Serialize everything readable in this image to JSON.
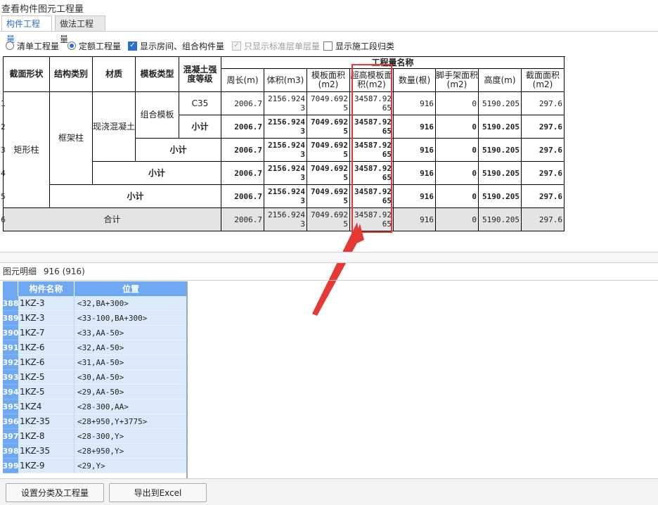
{
  "window": {
    "title": "查看构件图元工程量"
  },
  "tabs": [
    {
      "label": "构件工程量",
      "active": true
    },
    {
      "label": "做法工程量",
      "active": false
    }
  ],
  "options": {
    "radio_list": "清单工程量",
    "radio_quota": "定额工程量",
    "radio_selected": "定额工程量",
    "chk_room": "显示房间、组合构件量",
    "chk_room_checked": true,
    "chk_std_floor": "只显示标准层单层量",
    "chk_std_floor_checked": true,
    "chk_std_floor_disabled": true,
    "chk_segment": "显示施工段归类",
    "chk_segment_checked": false
  },
  "table": {
    "group_header": "工程量名称",
    "headers": {
      "shape": "截面形状",
      "struct": "结构类别",
      "material": "材质",
      "formwork": "模板类型",
      "grade": "混凝土强度等级",
      "perimeter": "周长(m)",
      "volume": "体积(m3)",
      "form_area": "模板面积(m2)",
      "over_form": "超高模板面积(m2)",
      "count": "数量(根)",
      "scaffold": "脚手架面积(m2)",
      "height": "高度(m)",
      "section": "截面面积(m2)"
    },
    "row_numbers": [
      "1",
      "2",
      "3",
      "4",
      "5",
      "6"
    ],
    "merged": {
      "shape": "矩形柱",
      "struct": "框架柱",
      "material": "现浇混凝土",
      "formwork": "组合模板",
      "grade": "C35",
      "subtotal": "小计",
      "total": "合计"
    },
    "values": {
      "perimeter": "2006.7",
      "volume": "2156.9243",
      "form_area": "7049.6925",
      "over_form": "34587.9265",
      "count": "916",
      "scaffold": "0",
      "height": "5190.205",
      "section": "297.6"
    }
  },
  "detail": {
    "label": "图元明细",
    "count_text": "916 (916)",
    "headers": {
      "name": "构件名称",
      "position": "位置"
    },
    "rows": [
      {
        "no": "388",
        "name": "1KZ-3",
        "pos": "<32,BA+300>"
      },
      {
        "no": "389",
        "name": "1KZ-3",
        "pos": "<33-100,BA+300>"
      },
      {
        "no": "390",
        "name": "1KZ-7",
        "pos": "<33,AA-50>"
      },
      {
        "no": "391",
        "name": "1KZ-6",
        "pos": "<32,AA-50>"
      },
      {
        "no": "392",
        "name": "1KZ-6",
        "pos": "<31,AA-50>"
      },
      {
        "no": "393",
        "name": "1KZ-5",
        "pos": "<30,AA-50>"
      },
      {
        "no": "394",
        "name": "1KZ-5",
        "pos": "<29,AA-50>"
      },
      {
        "no": "395",
        "name": "1KZ4",
        "pos": "<28-300,AA>"
      },
      {
        "no": "396",
        "name": "1KZ-35",
        "pos": "<28+950,Y+3775>"
      },
      {
        "no": "397",
        "name": "1KZ-8",
        "pos": "<28-300,Y>"
      },
      {
        "no": "398",
        "name": "1KZ-35",
        "pos": "<28+950,Y>"
      },
      {
        "no": "399",
        "name": "1KZ-9",
        "pos": "<29,Y>"
      }
    ]
  },
  "buttons": {
    "set_category": "设置分类及工程量",
    "export_excel": "导出到Excel"
  },
  "colors": {
    "highlight": "#e53935",
    "accent": "#2a6ecf",
    "detail_header": "#6fa8f2",
    "detail_cell": "#dbeafb"
  }
}
